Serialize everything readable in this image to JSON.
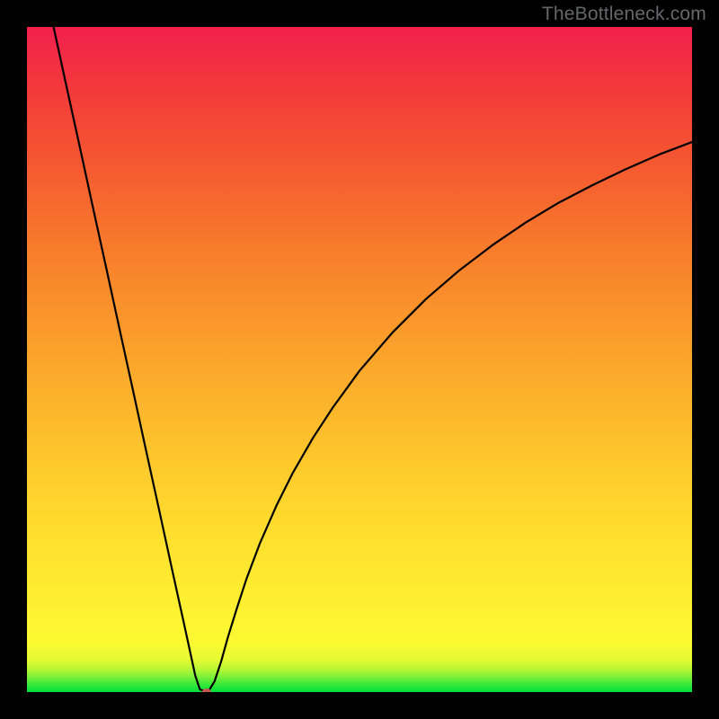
{
  "watermark": "TheBottleneck.com",
  "chart_data": {
    "type": "line",
    "title": "",
    "xlabel": "",
    "ylabel": "",
    "xlim": [
      0,
      100
    ],
    "ylim": [
      0,
      100
    ],
    "grid": false,
    "legend": false,
    "marker": {
      "x": 27,
      "y": 0,
      "color": "#c55a4a",
      "rx": 5,
      "ry": 4
    },
    "series": [
      {
        "name": "curve",
        "color": "#000000",
        "x": [
          4,
          6,
          8,
          10,
          12,
          14,
          16,
          18,
          20,
          22,
          23.5,
          24.5,
          25.3,
          26,
          26.6,
          27.4,
          28.2,
          29.2,
          30.2,
          31.5,
          33,
          35,
          37.5,
          40,
          43,
          46,
          50,
          55,
          60,
          65,
          70,
          75,
          80,
          85,
          90,
          95,
          100
        ],
        "y": [
          100,
          90.8,
          81.7,
          72.5,
          63.4,
          54.2,
          45.1,
          35.9,
          26.8,
          17.6,
          10.8,
          6.2,
          2.5,
          0.4,
          0.2,
          0.3,
          1.6,
          4.6,
          8.2,
          12.4,
          17.0,
          22.3,
          28.0,
          33.0,
          38.2,
          42.8,
          48.3,
          54.1,
          59.1,
          63.4,
          67.2,
          70.6,
          73.6,
          76.2,
          78.6,
          80.8,
          82.7
        ]
      }
    ]
  }
}
